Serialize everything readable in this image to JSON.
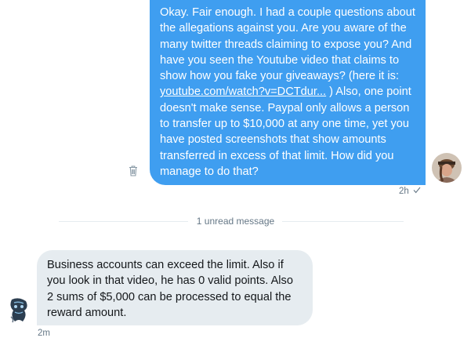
{
  "outgoing_message": {
    "text_before_link": "Okay. Fair enough. I had a couple questions about the allegations against you. Are you aware of the many twitter threads claiming to expose you? And have you seen the Youtube video that claims to show how you fake your giveaways? (here it is: ",
    "link_text": "youtube.com/watch?v=DCTdur...",
    "text_after_link": " )  Also, one point doesn't make sense. Paypal only allows a person to transfer up to $10,000 at any one time, yet you have posted screenshots that show amounts transferred in excess of that limit. How did you manage to do that?",
    "timestamp": "2h",
    "status_icon": "check-icon",
    "delete_icon": "trash-icon",
    "bubble_color": "#3f9ef0"
  },
  "divider": {
    "label": "1 unread message"
  },
  "incoming_message": {
    "text": "Business accounts can exceed the limit. Also if you look in that video, he has 0 valid points. Also 2 sums of $5,000 can be processed to equal the reward amount.",
    "timestamp": "2m",
    "bubble_color": "#e6ecf0"
  }
}
